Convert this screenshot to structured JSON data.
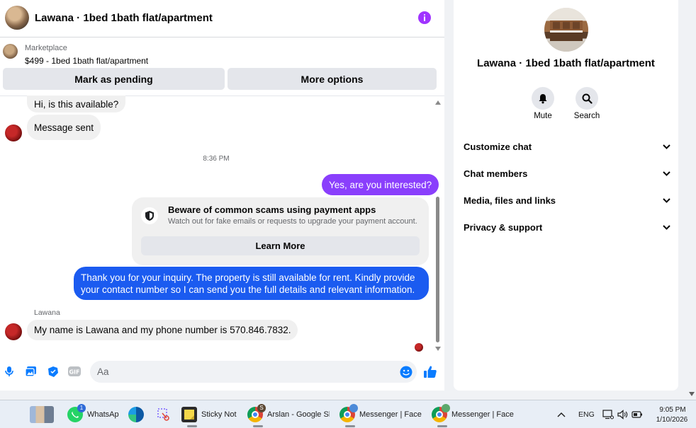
{
  "header": {
    "title": "Lawana · 1bed 1bath flat/apartment"
  },
  "listing": {
    "label": "Marketplace",
    "price_title": "$499 - 1bed 1bath flat/apartment",
    "mark_pending_label": "Mark as pending",
    "more_options_label": "More options"
  },
  "messages": {
    "m1": "Hi, is this available?",
    "m2": "Message sent",
    "timestamp": "8:36 PM",
    "m3": "Yes, are you interested?",
    "scam_title": "Beware of common scams using payment apps",
    "scam_subtitle": "Watch out for fake emails or requests to upgrade your payment account.",
    "learn_more": "Learn More",
    "m4": "Thank you for your inquiry. The property is still available for rent. Kindly provide your contact number so I can send you the full details and relevant information.",
    "sender_name": "Lawana",
    "m5": "My name is Lawana and my phone number is 570.846.7832."
  },
  "composer": {
    "placeholder": "Aa"
  },
  "details": {
    "title": "Lawana · 1bed 1bath flat/apartment",
    "mute_label": "Mute",
    "search_label": "Search",
    "sections": [
      "Customize chat",
      "Chat members",
      "Media, files and links",
      "Privacy & support"
    ]
  },
  "taskbar": {
    "whatsapp": "WhatsAp",
    "whatsapp_badge": "1",
    "sticky": "Sticky Note",
    "chrome1": "Arslan - Google Sh",
    "chrome1_badge": "S",
    "chrome2": "Messenger | Faceb",
    "chrome3": "Messenger | Faceb",
    "lang": "ENG",
    "time": "9:05 PM",
    "date": "1/10/2026"
  },
  "colors": {
    "accent_purple": "#a033ff",
    "bubble_purple": "#8a3ffc",
    "bubble_blue": "#1b5bf0",
    "messenger_blue": "#0a7cff"
  }
}
